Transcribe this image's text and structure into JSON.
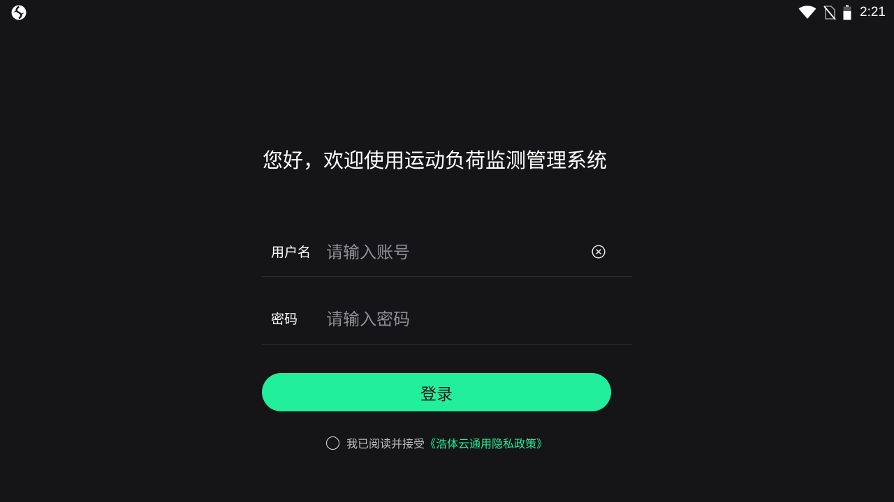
{
  "status_bar": {
    "time": "2:21"
  },
  "page": {
    "title": "您好，欢迎使用运动负荷监测管理系统"
  },
  "form": {
    "username": {
      "label": "用户名",
      "value": "",
      "placeholder": "请输入账号"
    },
    "password": {
      "label": "密码",
      "value": "",
      "placeholder": "请输入密码"
    },
    "login_label": "登录"
  },
  "agreement": {
    "checked": false,
    "text": "我已阅读并接受",
    "policy_link": "《浩体云通用隐私政策》"
  },
  "colors": {
    "background": "#151517",
    "accent": "#22ef9b",
    "placeholder": "#8e8e93"
  },
  "icons": [
    "app-logo-icon",
    "wifi-icon",
    "no-sim-icon",
    "battery-icon",
    "clear-icon",
    "radio-unchecked-icon"
  ]
}
